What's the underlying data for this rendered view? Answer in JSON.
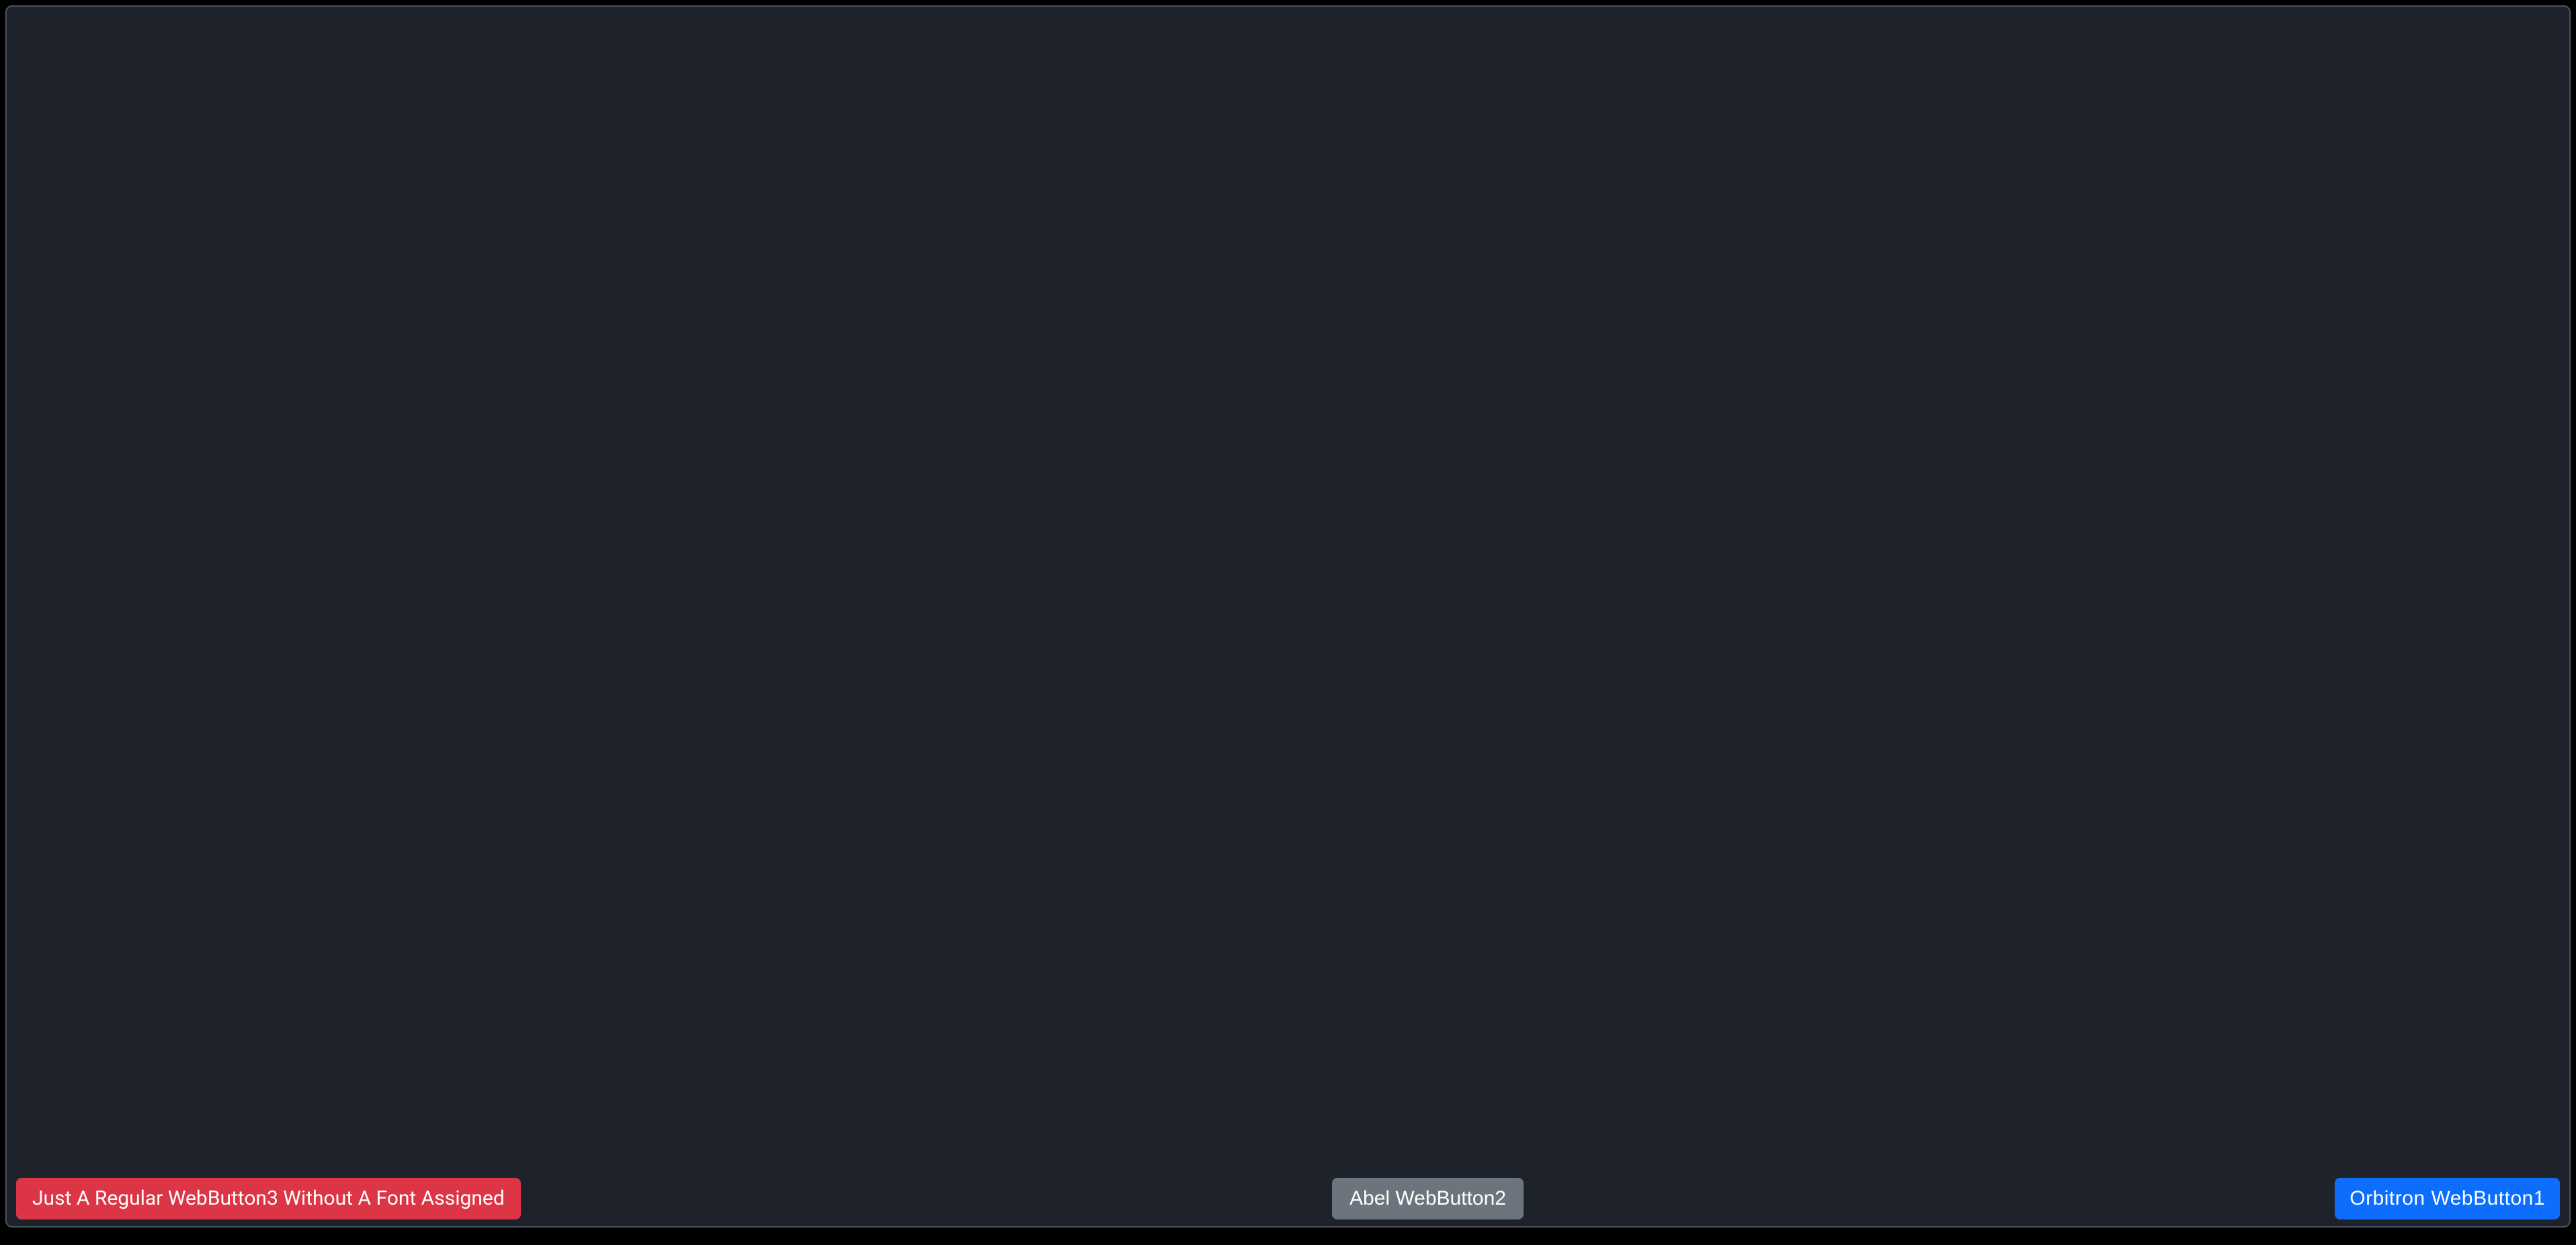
{
  "buttons": {
    "button3": {
      "label": "Just A Regular WebButton3 Without A Font Assigned"
    },
    "button2": {
      "label": "Abel WebButton2"
    },
    "button1": {
      "label": "Orbitron WebButton1"
    }
  },
  "colors": {
    "panel_bg": "#1e222a",
    "panel_border": "#4a5260",
    "danger": "#dc3545",
    "secondary": "#6c757d",
    "primary": "#0d6efd"
  }
}
